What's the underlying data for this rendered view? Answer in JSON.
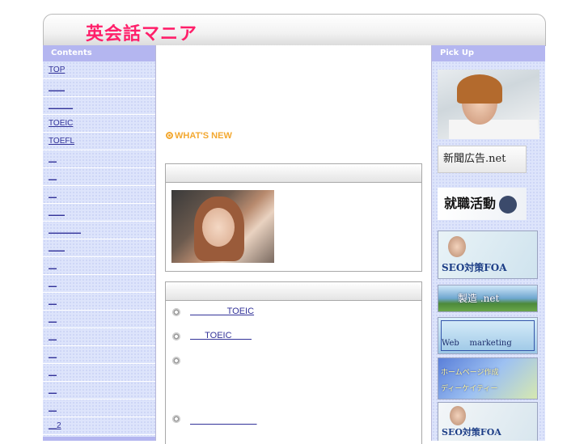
{
  "header": {
    "title": "英会話マニア"
  },
  "left": {
    "heading": "Contents",
    "items": [
      {
        "label": "TOP"
      },
      {
        "label": "＿＿"
      },
      {
        "label": "＿＿＿"
      },
      {
        "label": "TOEIC"
      },
      {
        "label": "TOEFL"
      },
      {
        "label": "＿"
      },
      {
        "label": "＿"
      },
      {
        "label": "＿"
      },
      {
        "label": "＿＿"
      },
      {
        "label": "＿＿＿＿"
      },
      {
        "label": "＿＿"
      },
      {
        "label": "＿"
      },
      {
        "label": "＿"
      },
      {
        "label": "＿"
      },
      {
        "label": "＿"
      },
      {
        "label": "＿"
      },
      {
        "label": "＿"
      },
      {
        "label": "＿"
      },
      {
        "label": "＿"
      },
      {
        "label": "＿"
      },
      {
        "label": "＿2"
      }
    ]
  },
  "center": {
    "whats_new": "WHAT'S NEW",
    "news": [
      {
        "text": "               TOEIC"
      },
      {
        "text": "      TOEIC        "
      },
      {
        "text": ""
      },
      {
        "text": "         ＿＿＿＿＿"
      }
    ]
  },
  "right": {
    "heading": "Pick Up",
    "banner_newspaper": "新聞広告.net",
    "banner_job": "就職活動",
    "banner_seo": "SEO対策FOA",
    "banner_manufacturing": "製造 .net",
    "banner_web": "Web    marketing",
    "banner_hp_line1": "ホームページ作成",
    "banner_hp_line2": "ディーケイティー",
    "banner_seo2": "SEO対策FOA"
  }
}
